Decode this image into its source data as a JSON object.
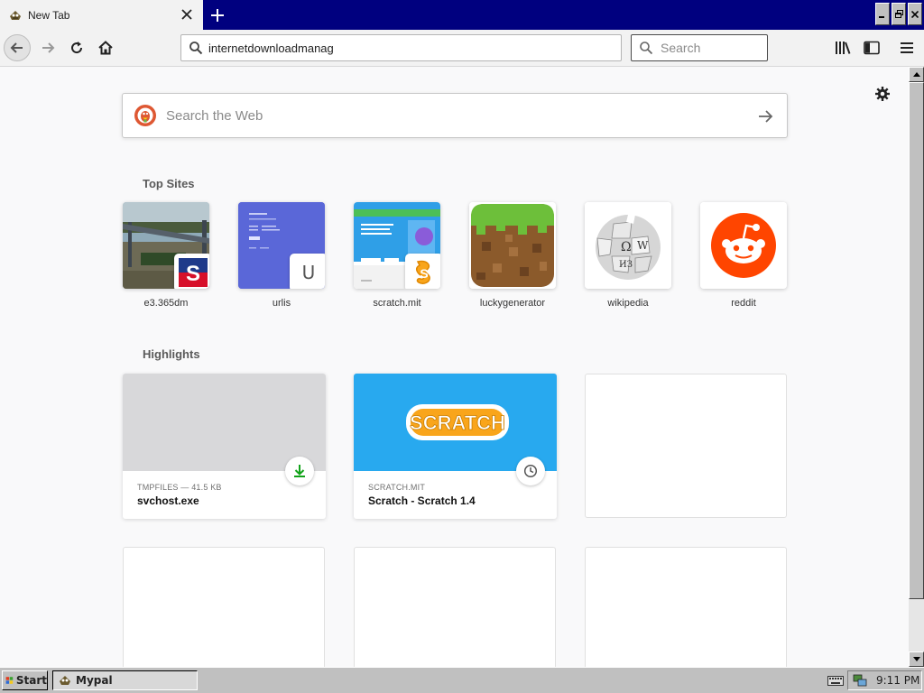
{
  "tab": {
    "title": "New Tab",
    "favicon": "mypal-icon"
  },
  "toolbar": {
    "url": "internetdownloadmanag",
    "search_placeholder": "Search"
  },
  "newtab_page": {
    "web_search_placeholder": "Search the Web",
    "top_sites_title": "Top Sites",
    "top_sites": [
      {
        "label": "e3.365dm"
      },
      {
        "label": "urlis",
        "letter": "U"
      },
      {
        "label": "scratch.mit"
      },
      {
        "label": "luckygenerator"
      },
      {
        "label": "wikipedia"
      },
      {
        "label": "reddit"
      }
    ],
    "highlights_title": "Highlights",
    "highlights": [
      {
        "meta": "TMPFILES — 41.5 KB",
        "title": "svchost.exe",
        "badge": "download-icon"
      },
      {
        "meta": "SCRATCH.MIT",
        "title": "Scratch - Scratch 1.4",
        "badge": "clock-icon",
        "logo_text": "SCRATCH"
      }
    ]
  },
  "taskbar": {
    "start_label": "Start",
    "task_label": "Mypal",
    "clock": "9:11 PM"
  },
  "colors": {
    "titlebar": "#00007f",
    "scratch_blue": "#28a9ef",
    "reddit": "#ff4500",
    "download_green": "#12a31a"
  }
}
